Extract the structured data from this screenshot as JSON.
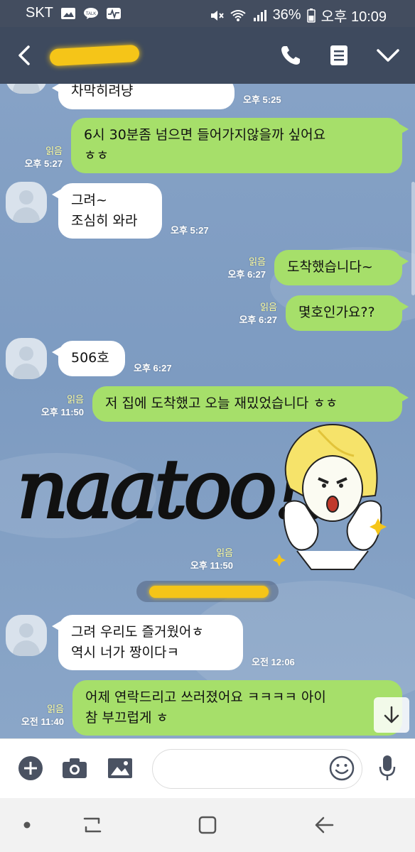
{
  "status_bar": {
    "carrier": "SKT",
    "battery": "36%",
    "time": "오후 10:09",
    "icons": [
      "gallery-icon",
      "talk-icon",
      "activity-icon",
      "mute-icon",
      "wifi-icon",
      "signal-icon",
      "battery-icon"
    ]
  },
  "header": {
    "contact_name": "(redacted)",
    "icons": [
      "back-icon",
      "phone-icon",
      "menu-doc-icon",
      "chevron-down-icon"
    ]
  },
  "messages": [
    {
      "side": "in",
      "lines": "차막히려냥",
      "time": "오후 5:25"
    },
    {
      "side": "out",
      "lines": "6시 30분좀 넘으면 들어가지않을까 싶어요\nㅎㅎ",
      "read": "읽음",
      "time": "오후 5:27"
    },
    {
      "side": "in",
      "lines": "그려~\n조심히 와라",
      "time": "오후 5:27"
    },
    {
      "side": "out",
      "lines": "도착했습니다~",
      "read": "읽음",
      "time": "오후 6:27"
    },
    {
      "side": "out",
      "lines": "몇호인가요??",
      "read": "읽음",
      "time": "오후 6:27"
    },
    {
      "side": "in",
      "lines": "506호",
      "time": "오후 6:27"
    },
    {
      "side": "out",
      "lines": "저 집에 도착했고 오늘 재밌었습니다 ㅎㅎ",
      "read": "읽음",
      "time": "오후 11:50"
    },
    {
      "side": "out",
      "type": "sticker",
      "read": "읽음",
      "time": "오후 11:50"
    },
    {
      "side": "in",
      "lines": "그려 우리도 즐거웠어ㅎ\n역시 너가 짱이다ㅋ",
      "time": "오전 12:06"
    },
    {
      "side": "out",
      "lines": "어제 연락드리고 쓰러졌어요 ㅋㅋㅋㅋ 아이\n참 부끄럽게 ㅎ",
      "read": "읽음",
      "time": "오전 11:40"
    }
  ],
  "watermark": "naatoo!!",
  "date_divider": "(redacted)",
  "input": {
    "placeholder": "",
    "value": ""
  },
  "colors": {
    "header": "#3e4a5e",
    "chat_bg": "#7e9bc0",
    "out_bubble": "#a6df6a",
    "in_bubble": "#ffffff",
    "read_mark": "#fbfb9e"
  }
}
